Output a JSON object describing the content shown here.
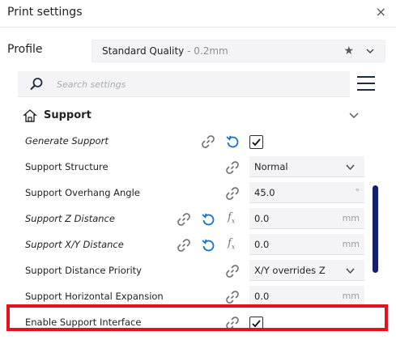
{
  "window": {
    "title": "Print settings",
    "close_glyph": "×"
  },
  "profile": {
    "label": "Profile",
    "value": "Standard Quality",
    "sub": " - 0.2mm",
    "star_glyph": "★"
  },
  "search": {
    "placeholder": "Search settings"
  },
  "section": {
    "title": "Support"
  },
  "settings": [
    {
      "label": "Generate Support",
      "control": "checkbox",
      "checked": true
    },
    {
      "label": "Support Structure",
      "control": "select",
      "value": "Normal"
    },
    {
      "label": "Support Overhang Angle",
      "control": "number",
      "value": "45.0",
      "unit": "°"
    },
    {
      "label": "Support Z Distance",
      "control": "number",
      "value": "0.0",
      "unit": "mm"
    },
    {
      "label": "Support X/Y Distance",
      "control": "number",
      "value": "0.0",
      "unit": "mm"
    },
    {
      "label": "Support Distance Priority",
      "control": "select",
      "value": "X/Y overrides Z"
    },
    {
      "label": "Support Horizontal Expansion",
      "control": "number",
      "value": "0.0",
      "unit": "mm"
    },
    {
      "label": "Enable Support Interface",
      "control": "checkbox",
      "checked": true
    }
  ],
  "icons": {
    "close": "close-icon",
    "star": "star-icon",
    "chevron": "chevron-down-icon",
    "search": "search-icon",
    "menu": "hamburger-menu-icon",
    "support": "support-icon",
    "link": "link-icon",
    "reset": "reset-icon",
    "function": "function-icon",
    "check": "checkmark-icon"
  },
  "colors": {
    "accent": "#1a6fc9",
    "scrollbar": "#16206a",
    "highlight": "#e8101a"
  }
}
